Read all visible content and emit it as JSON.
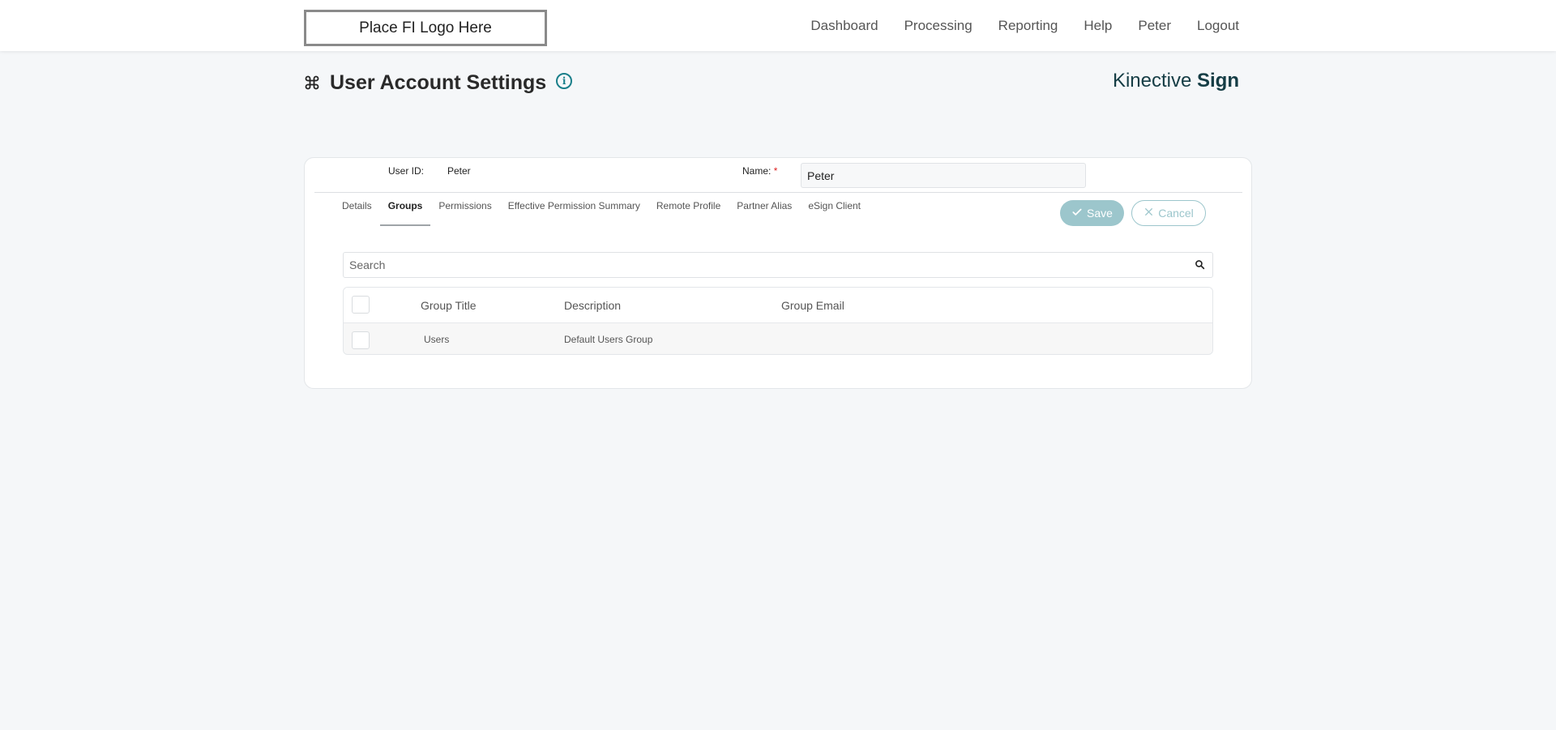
{
  "header": {
    "logo_text": "Place FI Logo Here",
    "nav": [
      "Dashboard",
      "Processing",
      "Reporting",
      "Help",
      "Peter",
      "Logout"
    ]
  },
  "page": {
    "title": "User Account Settings",
    "info_icon": "info-icon",
    "title_icon": "command-icon",
    "brand_light": "Kinective",
    "brand_bold": "Sign"
  },
  "form": {
    "userid_label": "User ID:",
    "userid_value": "Peter",
    "name_label": "Name:",
    "required_marker": "*",
    "name_value": "Peter"
  },
  "tabs": [
    {
      "label": "Details",
      "active": false
    },
    {
      "label": "Groups",
      "active": true
    },
    {
      "label": "Permissions",
      "active": false
    },
    {
      "label": "Effective Permission Summary",
      "active": false
    },
    {
      "label": "Remote Profile",
      "active": false
    },
    {
      "label": "Partner Alias",
      "active": false
    },
    {
      "label": "eSign Client",
      "active": false
    }
  ],
  "actions": {
    "save_label": "Save",
    "cancel_label": "Cancel"
  },
  "search": {
    "placeholder": "Search"
  },
  "table": {
    "columns": [
      "Group Title",
      "Description",
      "Group Email"
    ],
    "rows": [
      {
        "title": "Users",
        "description": "Default Users Group",
        "email": ""
      }
    ]
  },
  "colors": {
    "accent": "#1a7f8a",
    "button_teal": "#9cc6cc",
    "background": "#f5f7f9"
  }
}
